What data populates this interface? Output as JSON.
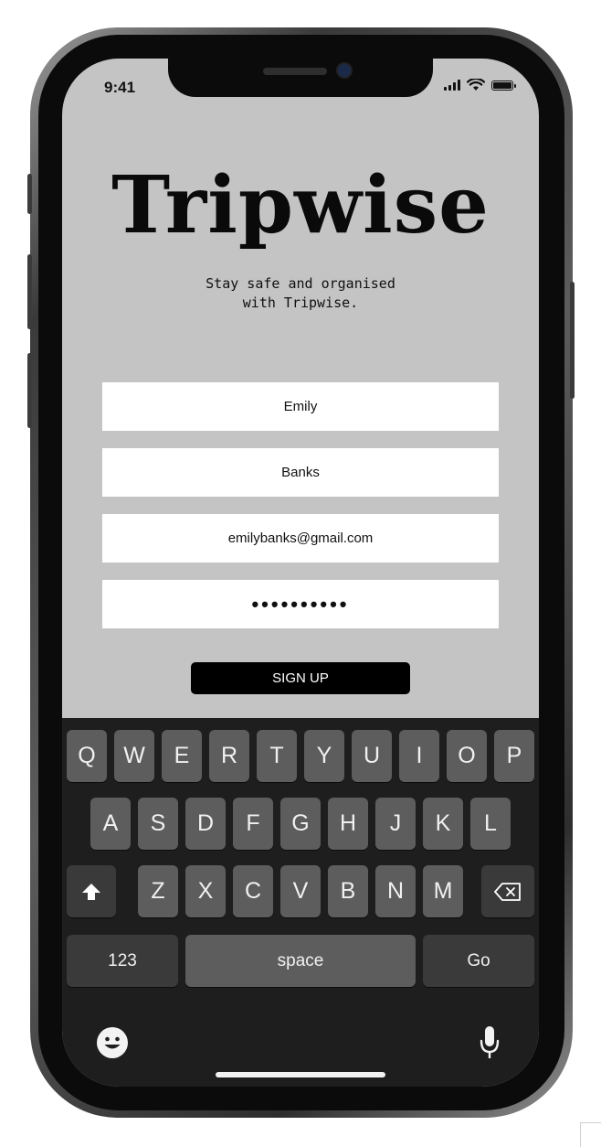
{
  "status_bar": {
    "time": "9:41"
  },
  "app": {
    "name": "Tripwise",
    "tagline_line1": "Stay safe and organised",
    "tagline_line2": "with Tripwise."
  },
  "form": {
    "first_name": "Emily",
    "last_name": "Banks",
    "email": "emilybanks@gmail.com",
    "password_masked": "••••••••••",
    "signup_label": "SIGN UP"
  },
  "keyboard": {
    "row1": [
      "Q",
      "W",
      "E",
      "R",
      "T",
      "Y",
      "U",
      "I",
      "O",
      "P"
    ],
    "row2": [
      "A",
      "S",
      "D",
      "F",
      "G",
      "H",
      "J",
      "K",
      "L"
    ],
    "row3": [
      "Z",
      "X",
      "C",
      "V",
      "B",
      "N",
      "M"
    ],
    "numbers_label": "123",
    "space_label": "space",
    "go_label": "Go",
    "icons": [
      "shift-icon",
      "backspace-icon",
      "emoji-icon",
      "microphone-icon"
    ]
  },
  "colors": {
    "screen_bg": "#c4c4c4",
    "button_bg": "#000000",
    "keyboard_bg": "#1e1e1e",
    "key_bg": "#5d5d5d"
  }
}
